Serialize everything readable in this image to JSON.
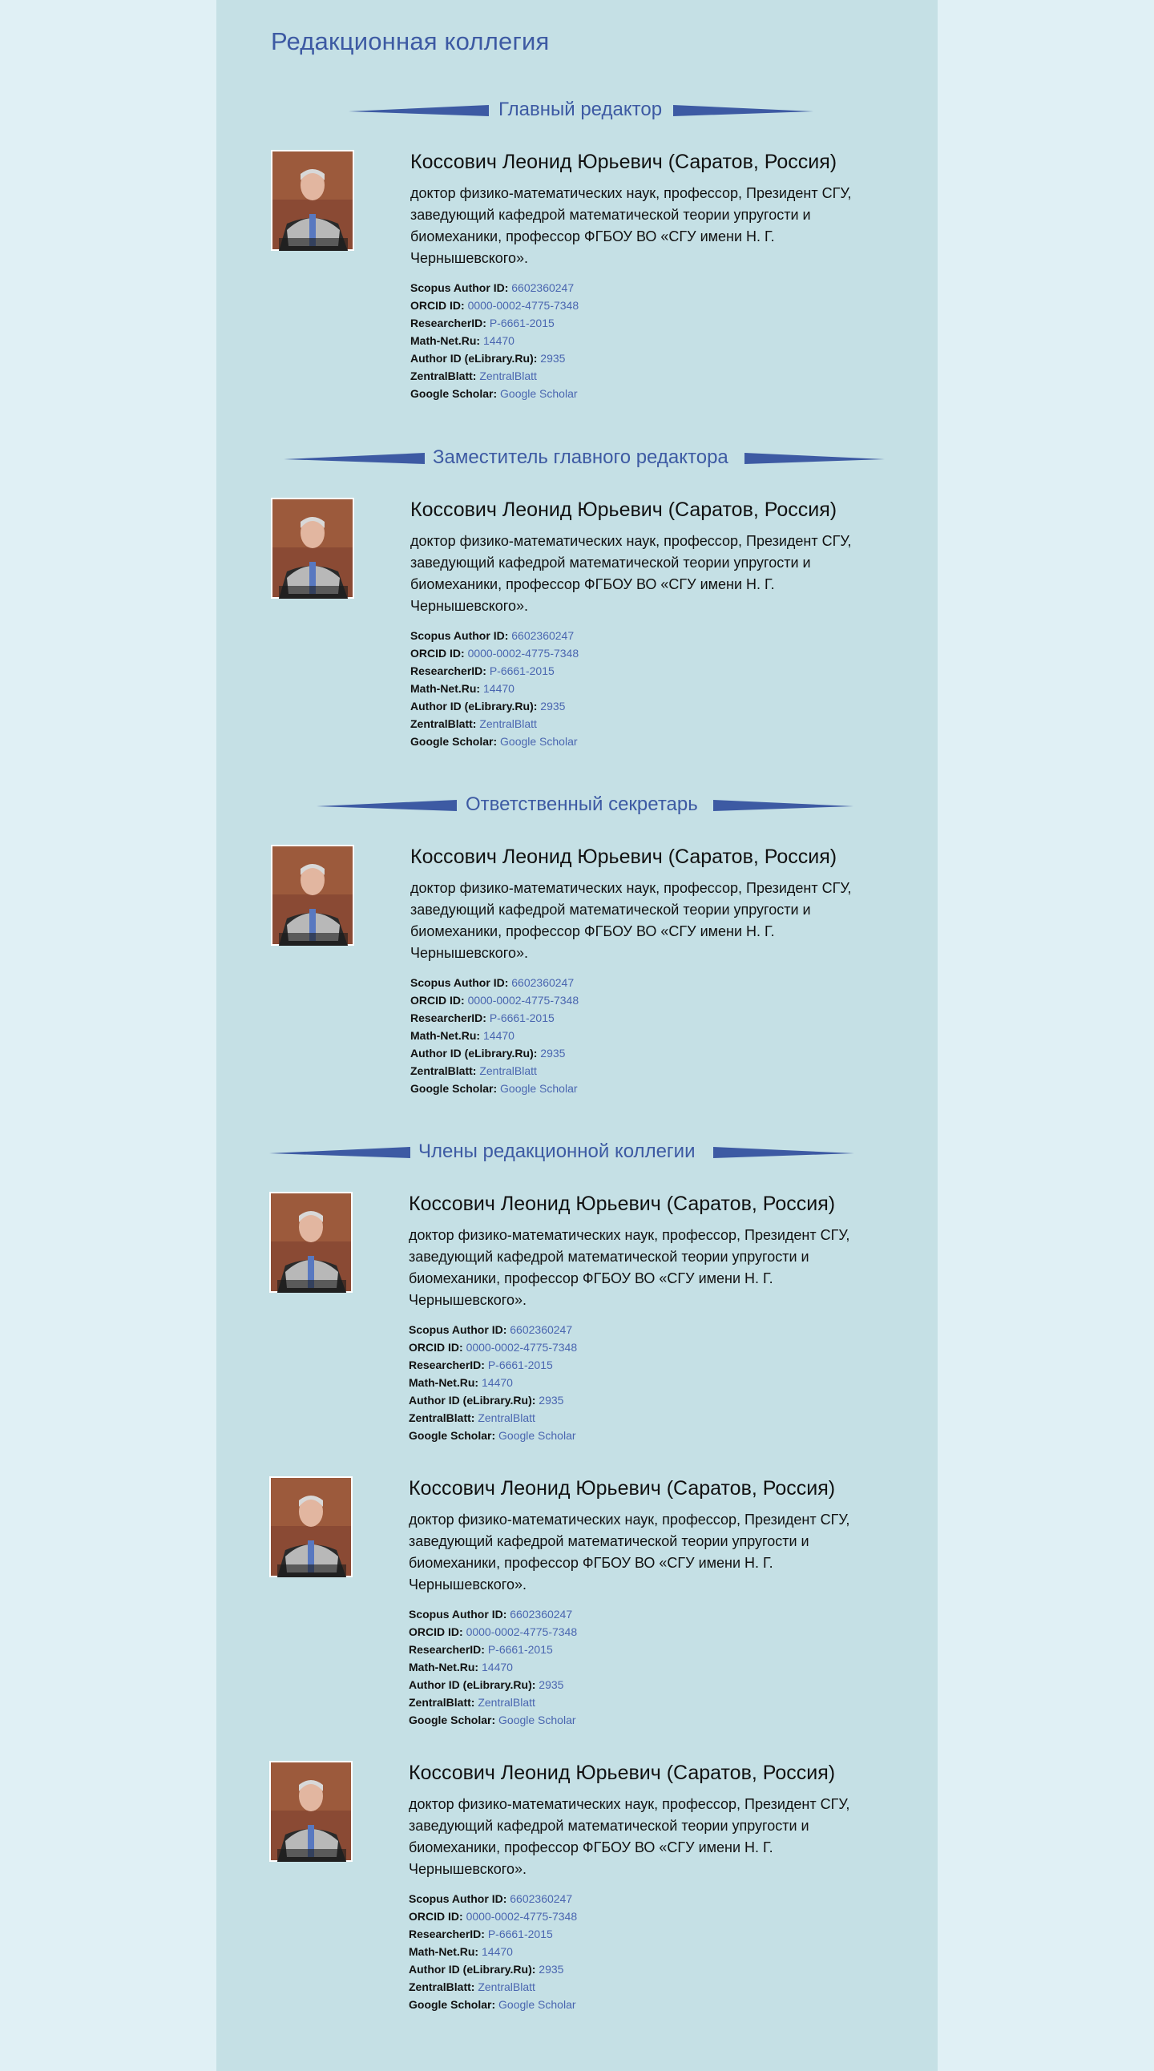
{
  "page_title": "Редакционная коллегия",
  "colors": {
    "outer_background": "#e0f0f5",
    "content_background": "#c5e0e5",
    "accent": "#3d5aa3",
    "link": "#4a66b0"
  },
  "sections": [
    {
      "heading": "Главный редактор",
      "members": [
        {
          "name": "Коссович Леонид Юрьевич (Саратов, Россия)",
          "description": "доктор физико-математических наук, профессор, Президент СГУ, заведующий кафедрой математической теории упругости и биомеханики, профессор ФГБОУ ВО «СГУ имени Н. Г. Чернышевского».",
          "ids": [
            {
              "label": "Scopus Author ID:",
              "value": "6602360247"
            },
            {
              "label": "ORCID ID:",
              "value": "0000-0002-4775-7348"
            },
            {
              "label": "ResearcherID:",
              "value": "P-6661-2015"
            },
            {
              "label": "Math-Net.Ru:",
              "value": "14470"
            },
            {
              "label": "Author ID (eLibrary.Ru):",
              "value": "2935"
            },
            {
              "label": "ZentralBlatt:",
              "value": "ZentralBlatt"
            },
            {
              "label": "Google Scholar:",
              "value": "Google Scholar"
            }
          ]
        }
      ]
    },
    {
      "heading": "Заместитель главного редактора",
      "members": [
        {
          "name": "Коссович Леонид Юрьевич (Саратов, Россия)",
          "description": "доктор физико-математических наук, профессор, Президент СГУ, заведующий кафедрой математической теории упругости и биомеханики, профессор ФГБОУ ВО «СГУ имени Н. Г. Чернышевского».",
          "ids": [
            {
              "label": "Scopus Author ID:",
              "value": "6602360247"
            },
            {
              "label": "ORCID ID:",
              "value": "0000-0002-4775-7348"
            },
            {
              "label": "ResearcherID:",
              "value": "P-6661-2015"
            },
            {
              "label": "Math-Net.Ru:",
              "value": "14470"
            },
            {
              "label": "Author ID (eLibrary.Ru):",
              "value": "2935"
            },
            {
              "label": "ZentralBlatt:",
              "value": "ZentralBlatt"
            },
            {
              "label": "Google Scholar:",
              "value": "Google Scholar"
            }
          ]
        }
      ]
    },
    {
      "heading": "Ответственный секретарь",
      "members": [
        {
          "name": "Коссович Леонид Юрьевич (Саратов, Россия)",
          "description": "доктор физико-математических наук, профессор, Президент СГУ, заведующий кафедрой математической теории упругости и биомеханики, профессор ФГБОУ ВО «СГУ имени Н. Г. Чернышевского».",
          "ids": [
            {
              "label": "Scopus Author ID:",
              "value": "6602360247"
            },
            {
              "label": "ORCID ID:",
              "value": "0000-0002-4775-7348"
            },
            {
              "label": "ResearcherID:",
              "value": "P-6661-2015"
            },
            {
              "label": "Math-Net.Ru:",
              "value": "14470"
            },
            {
              "label": "Author ID (eLibrary.Ru):",
              "value": "2935"
            },
            {
              "label": "ZentralBlatt:",
              "value": "ZentralBlatt"
            },
            {
              "label": "Google Scholar:",
              "value": "Google Scholar"
            }
          ]
        }
      ]
    },
    {
      "heading": "Члены редакционной коллегии",
      "members": [
        {
          "name": "Коссович Леонид Юрьевич (Саратов, Россия)",
          "description": "доктор физико-математических наук, профессор, Президент СГУ, заведующий кафедрой математической теории упругости и биомеханики, профессор ФГБОУ ВО «СГУ имени Н. Г. Чернышевского».",
          "ids": [
            {
              "label": "Scopus Author ID:",
              "value": "6602360247"
            },
            {
              "label": "ORCID ID:",
              "value": "0000-0002-4775-7348"
            },
            {
              "label": "ResearcherID:",
              "value": "P-6661-2015"
            },
            {
              "label": "Math-Net.Ru:",
              "value": "14470"
            },
            {
              "label": "Author ID (eLibrary.Ru):",
              "value": "2935"
            },
            {
              "label": "ZentralBlatt:",
              "value": "ZentralBlatt"
            },
            {
              "label": "Google Scholar:",
              "value": "Google Scholar"
            }
          ]
        },
        {
          "name": "Коссович Леонид Юрьевич (Саратов, Россия)",
          "description": "доктор физико-математических наук, профессор, Президент СГУ, заведующий кафедрой математической теории упругости и биомеханики, профессор ФГБОУ ВО «СГУ имени Н. Г. Чернышевского».",
          "ids": [
            {
              "label": "Scopus Author ID:",
              "value": "6602360247"
            },
            {
              "label": "ORCID ID:",
              "value": "0000-0002-4775-7348"
            },
            {
              "label": "ResearcherID:",
              "value": "P-6661-2015"
            },
            {
              "label": "Math-Net.Ru:",
              "value": "14470"
            },
            {
              "label": "Author ID (eLibrary.Ru):",
              "value": "2935"
            },
            {
              "label": "ZentralBlatt:",
              "value": "ZentralBlatt"
            },
            {
              "label": "Google Scholar:",
              "value": "Google Scholar"
            }
          ]
        },
        {
          "name": "Коссович Леонид Юрьевич (Саратов, Россия)",
          "description": "доктор физико-математических наук, профессор, Президент СГУ, заведующий кафедрой математической теории упругости и биомеханики, профессор ФГБОУ ВО «СГУ имени Н. Г. Чернышевского».",
          "ids": [
            {
              "label": "Scopus Author ID:",
              "value": "6602360247"
            },
            {
              "label": "ORCID ID:",
              "value": "0000-0002-4775-7348"
            },
            {
              "label": "ResearcherID:",
              "value": "P-6661-2015"
            },
            {
              "label": "Math-Net.Ru:",
              "value": "14470"
            },
            {
              "label": "Author ID (eLibrary.Ru):",
              "value": "2935"
            },
            {
              "label": "ZentralBlatt:",
              "value": "ZentralBlatt"
            },
            {
              "label": "Google Scholar:",
              "value": "Google Scholar"
            }
          ]
        }
      ]
    }
  ]
}
